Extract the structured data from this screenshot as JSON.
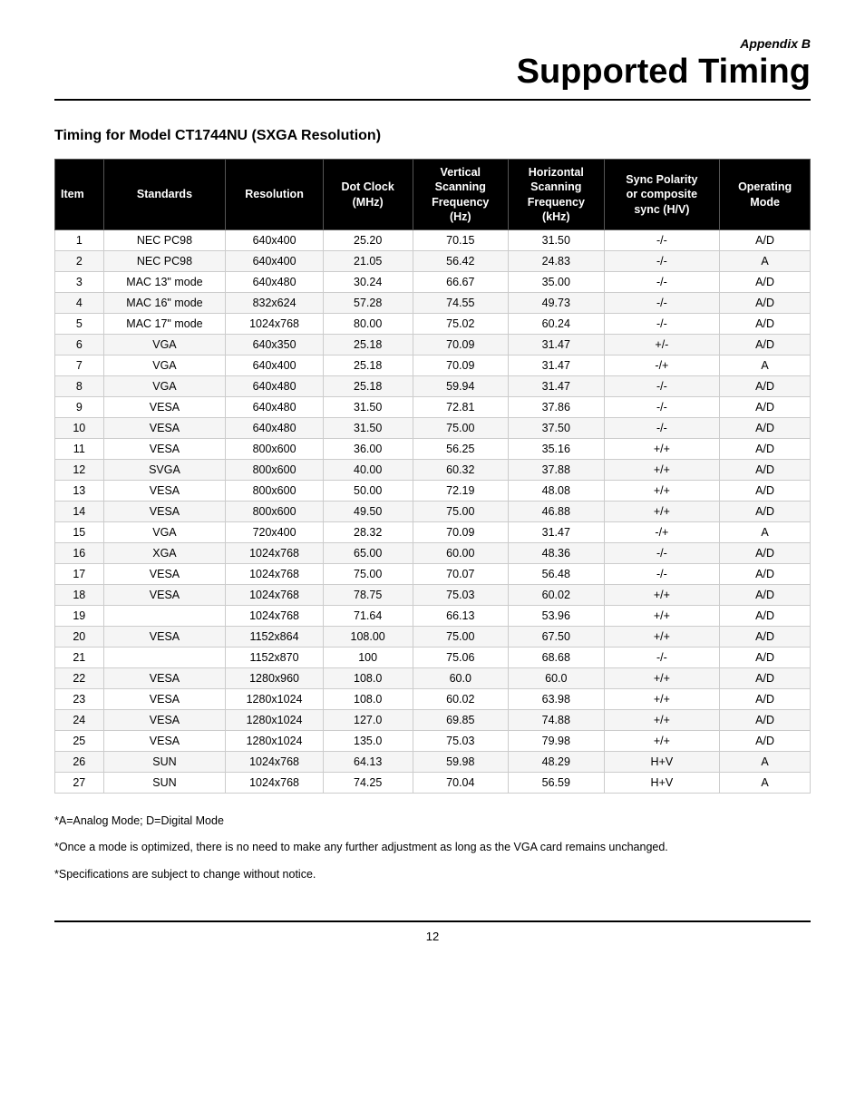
{
  "appendix_label": "Appendix B",
  "page_title": "Supported Timing",
  "section_title": "Timing for Model CT1744NU (SXGA Resolution)",
  "table": {
    "headers": [
      "Item",
      "Standards",
      "Resolution",
      "Dot Clock (MHz)",
      "Vertical Scanning Frequency (Hz)",
      "Horizontal Scanning Frequency (kHz)",
      "Sync Polarity or composite sync (H/V)",
      "Operating Mode"
    ],
    "rows": [
      [
        "1",
        "NEC PC98",
        "640x400",
        "25.20",
        "70.15",
        "31.50",
        "-/-",
        "A/D"
      ],
      [
        "2",
        "NEC PC98",
        "640x400",
        "21.05",
        "56.42",
        "24.83",
        "-/-",
        "A"
      ],
      [
        "3",
        "MAC 13\" mode",
        "640x480",
        "30.24",
        "66.67",
        "35.00",
        "-/-",
        "A/D"
      ],
      [
        "4",
        "MAC 16\" mode",
        "832x624",
        "57.28",
        "74.55",
        "49.73",
        "-/-",
        "A/D"
      ],
      [
        "5",
        "MAC 17\" mode",
        "1024x768",
        "80.00",
        "75.02",
        "60.24",
        "-/-",
        "A/D"
      ],
      [
        "6",
        "VGA",
        "640x350",
        "25.18",
        "70.09",
        "31.47",
        "+/-",
        "A/D"
      ],
      [
        "7",
        "VGA",
        "640x400",
        "25.18",
        "70.09",
        "31.47",
        "-/+",
        "A"
      ],
      [
        "8",
        "VGA",
        "640x480",
        "25.18",
        "59.94",
        "31.47",
        "-/-",
        "A/D"
      ],
      [
        "9",
        "VESA",
        "640x480",
        "31.50",
        "72.81",
        "37.86",
        "-/-",
        "A/D"
      ],
      [
        "10",
        "VESA",
        "640x480",
        "31.50",
        "75.00",
        "37.50",
        "-/-",
        "A/D"
      ],
      [
        "11",
        "VESA",
        "800x600",
        "36.00",
        "56.25",
        "35.16",
        "+/+",
        "A/D"
      ],
      [
        "12",
        "SVGA",
        "800x600",
        "40.00",
        "60.32",
        "37.88",
        "+/+",
        "A/D"
      ],
      [
        "13",
        "VESA",
        "800x600",
        "50.00",
        "72.19",
        "48.08",
        "+/+",
        "A/D"
      ],
      [
        "14",
        "VESA",
        "800x600",
        "49.50",
        "75.00",
        "46.88",
        "+/+",
        "A/D"
      ],
      [
        "15",
        "VGA",
        "720x400",
        "28.32",
        "70.09",
        "31.47",
        "-/+",
        "A"
      ],
      [
        "16",
        "XGA",
        "1024x768",
        "65.00",
        "60.00",
        "48.36",
        "-/-",
        "A/D"
      ],
      [
        "17",
        "VESA",
        "1024x768",
        "75.00",
        "70.07",
        "56.48",
        "-/-",
        "A/D"
      ],
      [
        "18",
        "VESA",
        "1024x768",
        "78.75",
        "75.03",
        "60.02",
        "+/+",
        "A/D"
      ],
      [
        "19",
        "",
        "1024x768",
        "71.64",
        "66.13",
        "53.96",
        "+/+",
        "A/D"
      ],
      [
        "20",
        "VESA",
        "1152x864",
        "108.00",
        "75.00",
        "67.50",
        "+/+",
        "A/D"
      ],
      [
        "21",
        "",
        "1152x870",
        "100",
        "75.06",
        "68.68",
        "-/-",
        "A/D"
      ],
      [
        "22",
        "VESA",
        "1280x960",
        "108.0",
        "60.0",
        "60.0",
        "+/+",
        "A/D"
      ],
      [
        "23",
        "VESA",
        "1280x1024",
        "108.0",
        "60.02",
        "63.98",
        "+/+",
        "A/D"
      ],
      [
        "24",
        "VESA",
        "1280x1024",
        "127.0",
        "69.85",
        "74.88",
        "+/+",
        "A/D"
      ],
      [
        "25",
        "VESA",
        "1280x1024",
        "135.0",
        "75.03",
        "79.98",
        "+/+",
        "A/D"
      ],
      [
        "26",
        "SUN",
        "1024x768",
        "64.13",
        "59.98",
        "48.29",
        "H+V",
        "A"
      ],
      [
        "27",
        "SUN",
        "1024x768",
        "74.25",
        "70.04",
        "56.59",
        "H+V",
        "A"
      ]
    ]
  },
  "footnotes": [
    "*A=Analog Mode; D=Digital Mode",
    "*Once a mode is optimized, there is no need to make any further adjustment as long as the VGA card remains unchanged.",
    "*Specifications are subject to change without notice."
  ],
  "page_number": "12"
}
